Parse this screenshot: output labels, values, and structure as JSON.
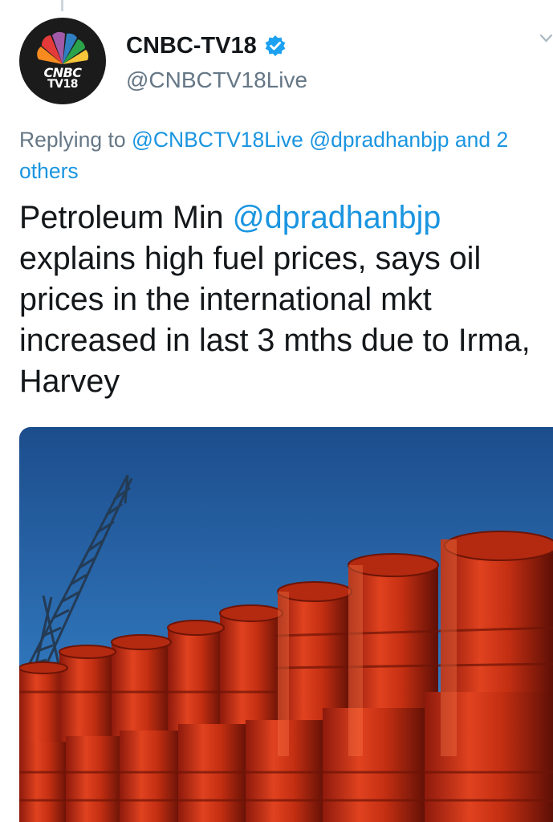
{
  "account": {
    "name": "CNBC-TV18",
    "handle": "@CNBCTV18Live",
    "avatar_text_1": "CNBC",
    "avatar_text_2": "TV18",
    "verified": true
  },
  "reply": {
    "prefix": "Replying to",
    "mention_1": "@CNBCTV18Live",
    "mention_2": "@dpradhanbjp",
    "suffix": "and 2 others"
  },
  "tweet": {
    "line_1_prefix": "Petroleum Min",
    "line_1_mention": "@dpradhanbjp",
    "body": "explains high fuel prices, says oil prices in the international mkt increased in last 3 mths due to Irma, Harvey"
  },
  "media": {
    "icon": "photo-oil-barrels-crane"
  },
  "colors": {
    "link": "#1b95e0",
    "secondary_text": "#657786",
    "primary_text": "#14171a",
    "verified": "#1da1f2"
  }
}
